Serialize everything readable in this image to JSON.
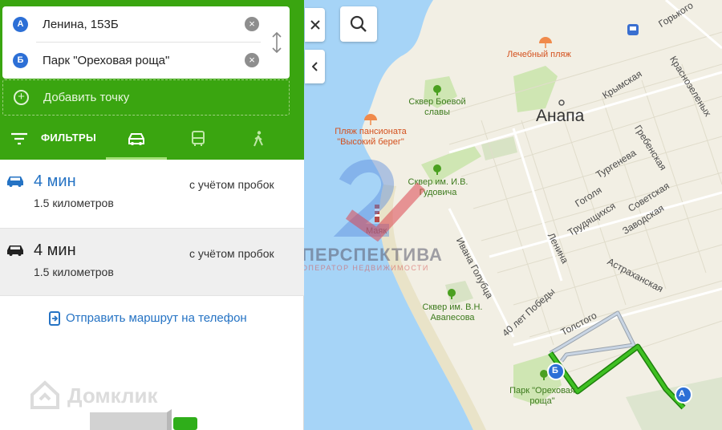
{
  "route_panel": {
    "point_a": {
      "marker": "А",
      "address": "Ленина, 153Б"
    },
    "point_b": {
      "marker": "Б",
      "address": "Парк \"Ореховая роща\""
    },
    "add_point_label": "Добавить точку",
    "filters_label": "ФИЛЬТРЫ",
    "active_mode": "car",
    "routes": [
      {
        "time": "4 мин",
        "traffic": "с учётом пробок",
        "distance": "1.5 километров",
        "selected": true
      },
      {
        "time": "4 мин",
        "traffic": "с учётом пробок",
        "distance": "1.5 километров",
        "selected": false
      }
    ],
    "send_label": "Отправить маршрут на телефон",
    "brand": "Домклик"
  },
  "map": {
    "city": "Анапа",
    "streets": [
      "Горького",
      "Краснозеленых",
      "Крымская",
      "Гребенская",
      "Тургенева",
      "Гоголя",
      "Трудящихся",
      "Советская",
      "Заводская",
      "Ленина",
      "Ивана Голубца",
      "Астраханская",
      "40 лет Победы",
      "Толстого"
    ],
    "pois": {
      "beach": "Лечебный пляж",
      "park1": "Сквер Боевой славы",
      "pension": "Пляж пансионата \"Высокий берег\"",
      "park2": "Сквер им. И.В. Гудовича",
      "lighthouse": "Маяк",
      "park3": "Сквер им. В.Н. Авanесова",
      "park4": "Парк \"Ореховая роща\""
    },
    "markers": {
      "a": "А",
      "b": "Б"
    }
  },
  "watermark": {
    "title": "ПЕРСПЕКТИВА",
    "subtitle": "ОПЕРАТОР НЕДВИЖИМОСТИ"
  },
  "colors": {
    "panel_green": "#3aa510",
    "route_green": "#2fae1a",
    "link_blue": "#2573c4",
    "sea": "#a6d4f7",
    "land": "#f2efe4"
  }
}
